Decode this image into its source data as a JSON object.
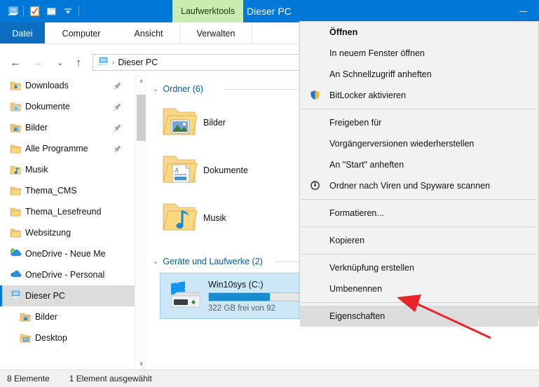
{
  "window": {
    "title": "Dieser PC",
    "contextual_tab_label": "Laufwerktools",
    "minimize_label": "Minimieren"
  },
  "quick_access_toolbar": {
    "items": [
      {
        "name": "this-pc-icon",
        "label": "Dieser PC"
      },
      {
        "name": "properties-icon",
        "label": "Eigenschaften"
      },
      {
        "name": "new-folder-icon",
        "label": "Neuer Ordner"
      },
      {
        "name": "customize-dropdown-icon",
        "label": "Symbolleiste anpassen"
      }
    ]
  },
  "ribbon": {
    "tabs": [
      {
        "label": "Datei",
        "active": false
      },
      {
        "label": "Computer",
        "active": false
      },
      {
        "label": "Ansicht",
        "active": false
      },
      {
        "label": "Verwalten",
        "active": true
      }
    ]
  },
  "navbar": {
    "back_label": "Zurück",
    "forward_label": "Vorwärts",
    "recent_label": "Zuletzt besuchte Orte",
    "up_label": "Eine Ebene nach oben",
    "address": {
      "icon": "this-pc-icon",
      "separator": "›",
      "crumb": "Dieser PC"
    }
  },
  "sidebar": {
    "items": [
      {
        "label": "Downloads",
        "icon": "downloads-folder-icon",
        "pinned": true,
        "indent": false,
        "selected": false
      },
      {
        "label": "Dokumente",
        "icon": "documents-folder-icon",
        "pinned": true,
        "indent": false,
        "selected": false
      },
      {
        "label": "Bilder",
        "icon": "pictures-folder-icon",
        "pinned": true,
        "indent": false,
        "selected": false
      },
      {
        "label": "Alle Programme",
        "icon": "folder-icon",
        "pinned": true,
        "indent": false,
        "selected": false
      },
      {
        "label": "Musik",
        "icon": "music-folder-icon",
        "pinned": false,
        "indent": false,
        "selected": false
      },
      {
        "label": "Thema_CMS",
        "icon": "folder-icon",
        "pinned": false,
        "indent": false,
        "selected": false
      },
      {
        "label": "Thema_Lesefreund",
        "icon": "folder-icon",
        "pinned": false,
        "indent": false,
        "selected": false
      },
      {
        "label": "Websitzung",
        "icon": "folder-icon",
        "pinned": false,
        "indent": false,
        "selected": false
      },
      {
        "label": "OneDrive - Neue Me",
        "icon": "onedrive-business-icon",
        "pinned": false,
        "indent": false,
        "selected": false
      },
      {
        "label": "OneDrive - Personal",
        "icon": "onedrive-icon",
        "pinned": false,
        "indent": false,
        "selected": false
      },
      {
        "label": "Dieser PC",
        "icon": "this-pc-icon",
        "pinned": false,
        "indent": false,
        "selected": true
      },
      {
        "label": "Bilder",
        "icon": "pictures-folder-icon",
        "pinned": false,
        "indent": true,
        "selected": false
      },
      {
        "label": "Desktop",
        "icon": "desktop-folder-icon",
        "pinned": false,
        "indent": true,
        "selected": false
      }
    ]
  },
  "content": {
    "groups": [
      {
        "label": "Ordner (6)",
        "chevron": "⌄"
      },
      {
        "label": "Geräte und Laufwerke (2)",
        "chevron": "⌄"
      }
    ],
    "folders": [
      {
        "name": "Bilder",
        "icon": "pictures-folder-icon"
      },
      {
        "name": "Dokumente",
        "icon": "documents-folder-icon"
      },
      {
        "name": "Musik",
        "icon": "music-folder-icon"
      }
    ],
    "drives": [
      {
        "name": "Win10sys (C:)",
        "icon": "windows-drive-icon",
        "free_text": "322 GB frei von 92",
        "usage_percent": 65,
        "selected": true
      }
    ]
  },
  "context_menu": {
    "items": [
      {
        "label": "Öffnen",
        "bold": true,
        "icon": null,
        "highlighted": false
      },
      {
        "label": "In neuem Fenster öffnen",
        "bold": false,
        "icon": null,
        "highlighted": false
      },
      {
        "label": "An Schnellzugriff anheften",
        "bold": false,
        "icon": null,
        "highlighted": false
      },
      {
        "label": "BitLocker aktivieren",
        "bold": false,
        "icon": "shield-icon",
        "highlighted": false
      },
      {
        "separator": true
      },
      {
        "label": "Freigeben für",
        "bold": false,
        "icon": null,
        "highlighted": false
      },
      {
        "label": "Vorgängerversionen wiederherstellen",
        "bold": false,
        "icon": null,
        "highlighted": false
      },
      {
        "label": "An \"Start\" anheften",
        "bold": false,
        "icon": null,
        "highlighted": false
      },
      {
        "label": "Ordner nach Viren und Spyware scannen",
        "bold": false,
        "icon": "antivirus-icon",
        "highlighted": false
      },
      {
        "separator": true
      },
      {
        "label": "Formatieren...",
        "bold": false,
        "icon": null,
        "highlighted": false
      },
      {
        "separator": true
      },
      {
        "label": "Kopieren",
        "bold": false,
        "icon": null,
        "highlighted": false
      },
      {
        "separator": true
      },
      {
        "label": "Verknüpfung erstellen",
        "bold": false,
        "icon": null,
        "highlighted": false
      },
      {
        "label": "Umbenennen",
        "bold": false,
        "icon": null,
        "highlighted": false
      },
      {
        "separator": true
      },
      {
        "label": "Eigenschaften",
        "bold": false,
        "icon": null,
        "highlighted": true
      }
    ]
  },
  "statusbar": {
    "item_count": "8 Elemente",
    "selection": "1 Element ausgewählt"
  },
  "annotation": {
    "arrow_color": "#e8242a",
    "points_to": "Eigenschaften"
  },
  "colors": {
    "titlebar": "#0078d7",
    "contextual_tab": "#c9edb1",
    "accent": "#0078d7",
    "selection": "#cce8f7",
    "menu_bg": "#f2f2f2"
  }
}
